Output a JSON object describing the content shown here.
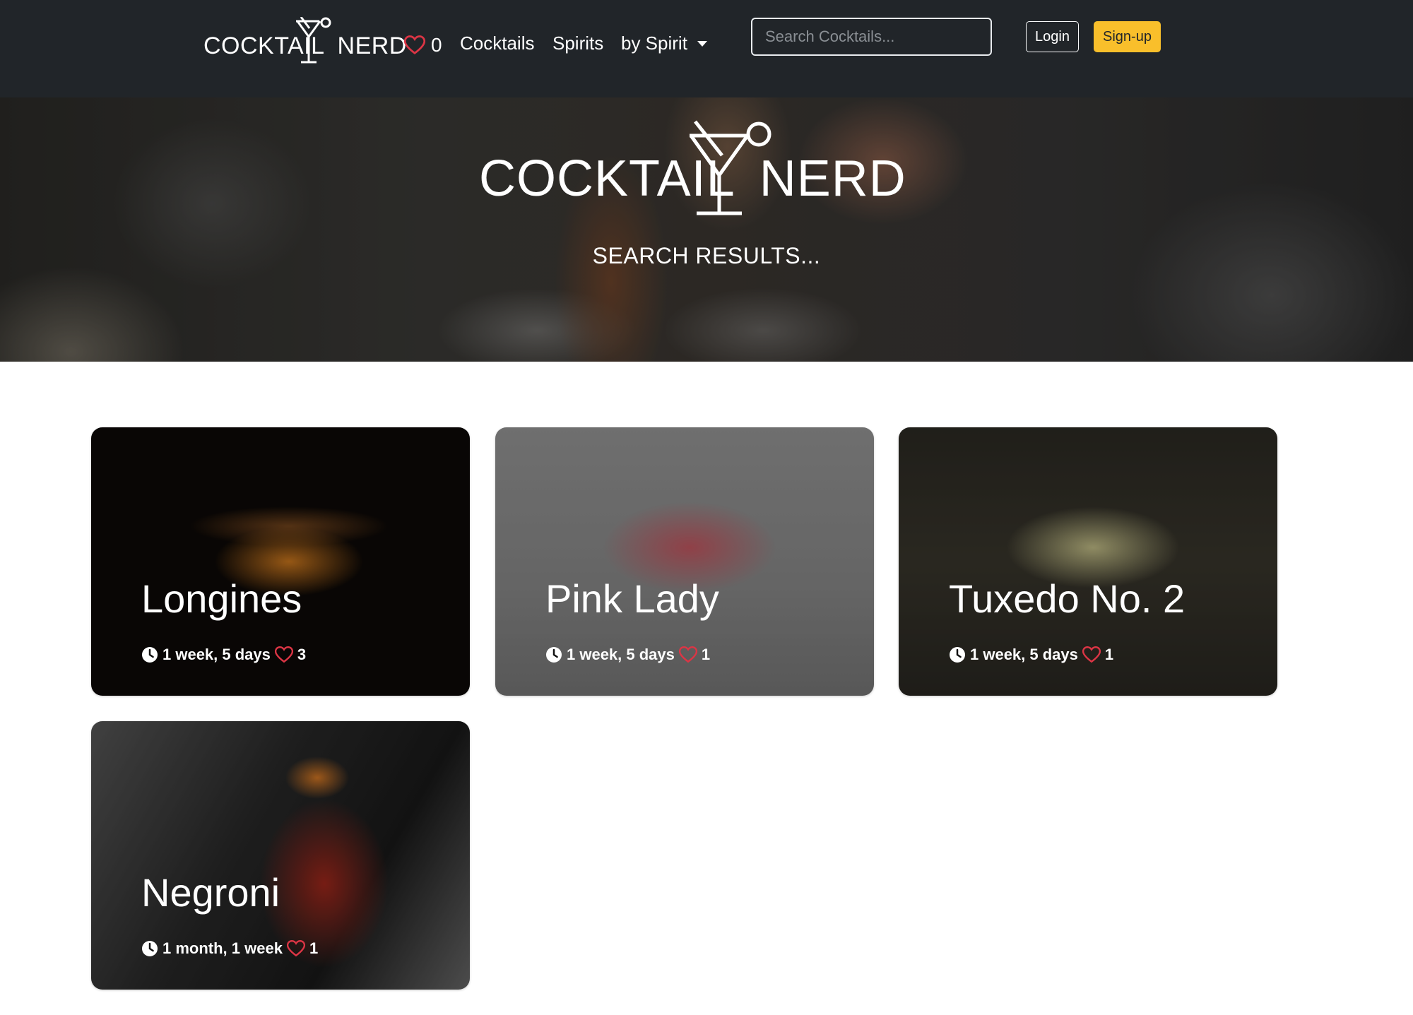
{
  "navbar": {
    "brand_left": "COCKTAIL",
    "brand_right": "NERD",
    "favorites_count": "0",
    "links": {
      "cocktails": "Cocktails",
      "spirits": "Spirits",
      "by_spirit": "by Spirit"
    },
    "search_placeholder": "Search Cocktails...",
    "login_label": "Login",
    "signup_label": "Sign-up"
  },
  "hero": {
    "brand_left": "COCKTAIL",
    "brand_right": "NERD",
    "subtitle": "SEARCH RESULTS..."
  },
  "cards": [
    {
      "title": "Longines",
      "age": "1 week, 5 days",
      "likes": "3"
    },
    {
      "title": "Pink Lady",
      "age": "1 week, 5 days",
      "likes": "1"
    },
    {
      "title": "Tuxedo No. 2",
      "age": "1 week, 5 days",
      "likes": "1"
    },
    {
      "title": "Negroni",
      "age": "1 month, 1 week",
      "likes": "1"
    }
  ],
  "colors": {
    "navbar_bg": "#212529",
    "signup_bg": "#f9bf2b",
    "heart": "#dc3545"
  }
}
